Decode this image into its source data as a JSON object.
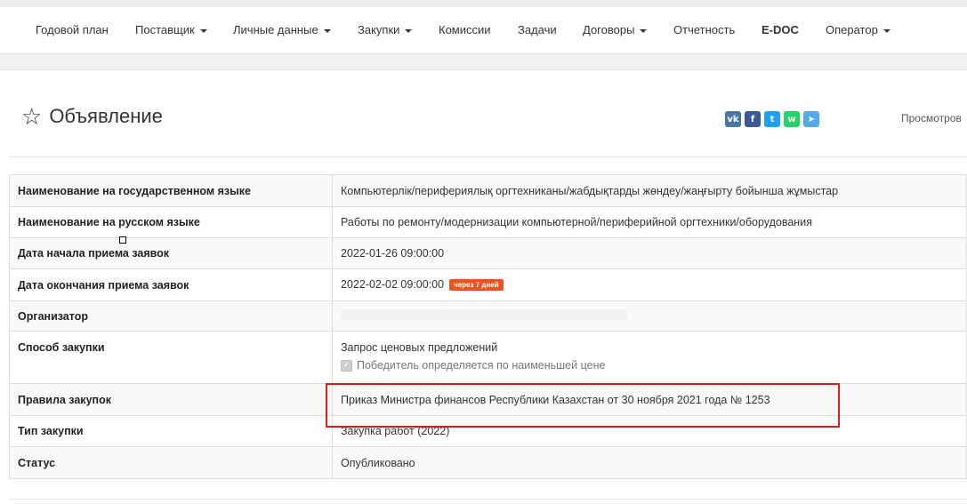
{
  "nav": {
    "items": [
      {
        "label": "Годовой план",
        "dropdown": false
      },
      {
        "label": "Поставщик",
        "dropdown": true
      },
      {
        "label": "Личные данные",
        "dropdown": true
      },
      {
        "label": "Закупки",
        "dropdown": true
      },
      {
        "label": "Комиссии",
        "dropdown": false
      },
      {
        "label": "Задачи",
        "dropdown": false
      },
      {
        "label": "Договоры",
        "dropdown": true
      },
      {
        "label": "Отчетность",
        "dropdown": false
      },
      {
        "label": "E-DOC",
        "dropdown": false
      },
      {
        "label": "Оператор",
        "dropdown": true
      }
    ]
  },
  "page": {
    "title": "Объявление",
    "views_label": "Просмотров"
  },
  "share": {
    "icons": [
      "vk-icon",
      "facebook-icon",
      "twitter-icon",
      "whatsapp-icon",
      "telegram-icon"
    ],
    "glyphs": [
      "vk",
      "f",
      "t",
      "w",
      "➤"
    ],
    "colors": [
      "#4a76a8",
      "#3b5998",
      "#1da1f2",
      "#25d366",
      "#54a9eb"
    ]
  },
  "details": {
    "name_kz_label": "Наименование на государственном языке",
    "name_kz_value": "Компьютерлік/перифериялық оргтехниканы/жабдықтарды жөндеу/жаңғырту бойынша жұмыстар",
    "name_ru_label": "Наименование на русском языке",
    "name_ru_value": "Работы по ремонту/модернизации компьютерной/периферийной оргтехники/оборудования",
    "start_label": "Дата начала приема заявок",
    "start_value": "2022-01-26 09:00:00",
    "end_label": "Дата окончания приема заявок",
    "end_value": "2022-02-02 09:00:00",
    "end_badge": "через 7 дней",
    "organizer_label": "Организатор",
    "method_label": "Способ закупки",
    "method_value": "Запрос ценовых предложений",
    "method_note": "Победитель определяется по наименьшей цене",
    "rules_label": "Правила закупок",
    "rules_value": "Приказ Министра финансов Республики Казахстан от 30 ноября 2021 года № 1253",
    "type_label": "Тип закупки",
    "type_value": "Закупка работ (2022)",
    "status_label": "Статус",
    "status_value": "Опубликовано"
  },
  "colors": {
    "badge": "#f0541e",
    "highlight": "#e01b1b"
  }
}
